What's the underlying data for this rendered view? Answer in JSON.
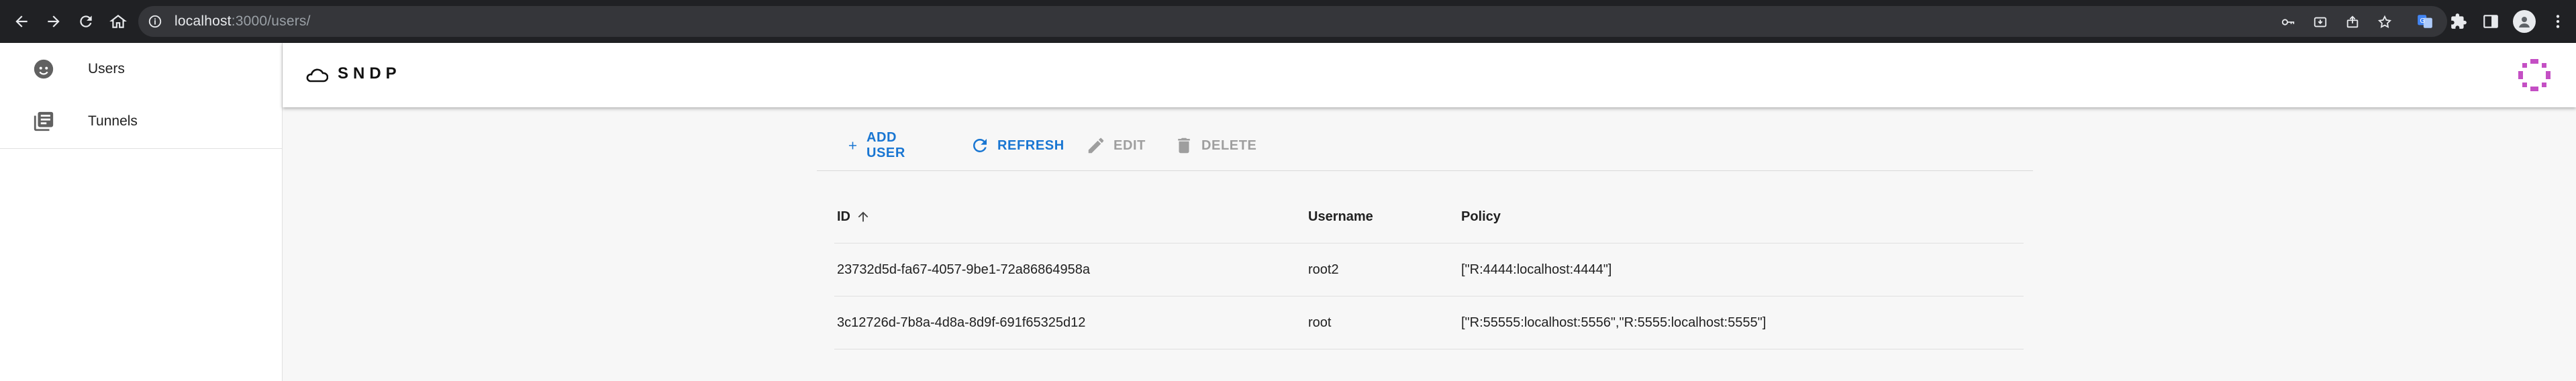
{
  "browser": {
    "url_host": "localhost",
    "url_rest": ":3000/users/"
  },
  "sidebar": {
    "items": [
      {
        "label": "Users",
        "icon": "face-icon"
      },
      {
        "label": "Tunnels",
        "icon": "library-books-icon"
      }
    ]
  },
  "appbar": {
    "brand": "SNDP"
  },
  "toolbar": {
    "add_label": "ADD USER",
    "refresh_label": "REFRESH",
    "edit_label": "EDIT",
    "delete_label": "DELETE"
  },
  "table": {
    "columns": [
      "ID",
      "Username",
      "Policy"
    ],
    "rows": [
      {
        "id": "23732d5d-fa67-4057-9be1-72a86864958a",
        "username": "root2",
        "policy": "[\"R:4444:localhost:4444\"]"
      },
      {
        "id": "3c12726d-7b8a-4d8a-8d9f-691f65325d12",
        "username": "root",
        "policy": "[\"R:55555:localhost:5556\",\"R:5555:localhost:5555\"]"
      }
    ]
  },
  "colors": {
    "accent": "#1976d2",
    "disabled": "#9e9e9e",
    "avatar": "#c44fc4"
  }
}
